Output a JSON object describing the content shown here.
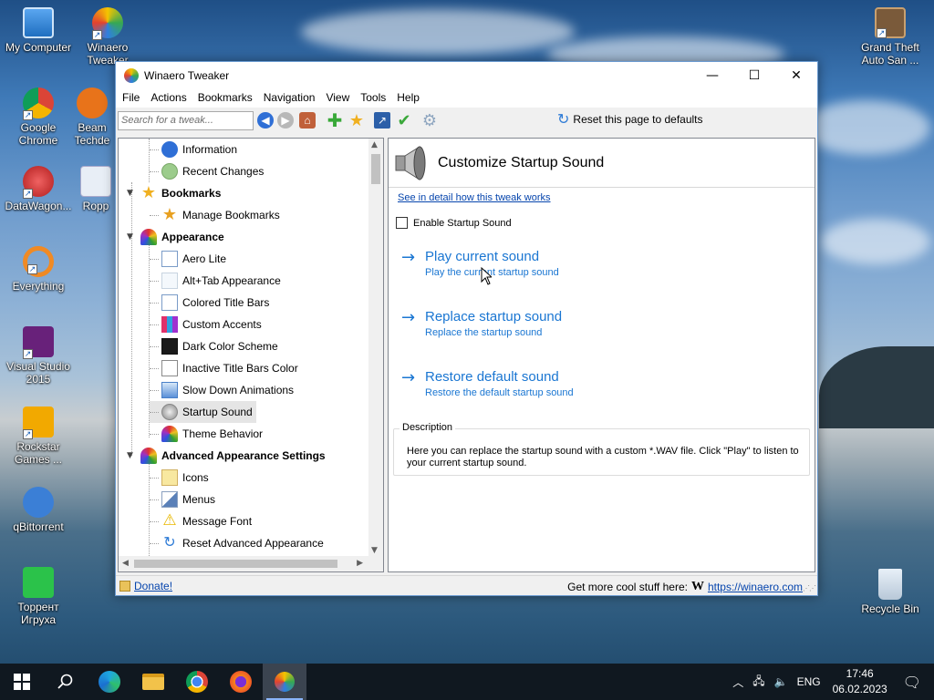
{
  "desktop": {
    "icons_left": [
      "My Computer",
      "Winaero Tweaker",
      "Google Chrome",
      "Beam Techde",
      "DataWagon...",
      "Ropp",
      "Everything",
      "Visual Studio 2015",
      "Rockstar Games ...",
      "qBittorrent",
      "Торрент Игруха"
    ],
    "icons_right": [
      "Grand Theft Auto San ...",
      "Recycle Bin"
    ]
  },
  "window": {
    "title": "Winaero Tweaker",
    "minimize": "—",
    "maximize": "☐",
    "close": "✕"
  },
  "menu": [
    "File",
    "Actions",
    "Bookmarks",
    "Navigation",
    "View",
    "Tools",
    "Help"
  ],
  "toolbar": {
    "search_placeholder": "Search for a tweak...",
    "reset_label": "Reset this page to defaults"
  },
  "tree": [
    {
      "label": "Information",
      "type": "item"
    },
    {
      "label": "Recent Changes",
      "type": "item"
    },
    {
      "label": "Bookmarks",
      "type": "cat"
    },
    {
      "label": "Manage Bookmarks",
      "type": "item"
    },
    {
      "label": "Appearance",
      "type": "cat"
    },
    {
      "label": "Aero Lite",
      "type": "item"
    },
    {
      "label": "Alt+Tab Appearance",
      "type": "item"
    },
    {
      "label": "Colored Title Bars",
      "type": "item"
    },
    {
      "label": "Custom Accents",
      "type": "item"
    },
    {
      "label": "Dark Color Scheme",
      "type": "item"
    },
    {
      "label": "Inactive Title Bars Color",
      "type": "item"
    },
    {
      "label": "Slow Down Animations",
      "type": "item"
    },
    {
      "label": "Startup Sound",
      "type": "item",
      "selected": true
    },
    {
      "label": "Theme Behavior",
      "type": "item"
    },
    {
      "label": "Advanced Appearance Settings",
      "type": "cat"
    },
    {
      "label": "Icons",
      "type": "item"
    },
    {
      "label": "Menus",
      "type": "item"
    },
    {
      "label": "Message Font",
      "type": "item"
    },
    {
      "label": "Reset Advanced Appearance",
      "type": "item"
    }
  ],
  "content": {
    "title": "Customize Startup Sound",
    "detail_link": "See in detail how this tweak works",
    "checkbox_label": "Enable Startup Sound",
    "actions": [
      {
        "title": "Play current sound",
        "subtitle": "Play the current startup sound"
      },
      {
        "title": "Replace startup sound",
        "subtitle": "Replace the startup sound"
      },
      {
        "title": "Restore default sound",
        "subtitle": "Restore the default startup sound"
      }
    ],
    "description_legend": "Description",
    "description_text": "Here you can replace the startup sound with a custom *.WAV file. Click \"Play\" to listen to your current startup sound."
  },
  "status": {
    "donate": "Donate!",
    "more_label": "Get more cool stuff here:",
    "url": "https://winaero.com"
  },
  "taskbar": {
    "language": "ENG",
    "time": "17:46",
    "date": "06.02.2023"
  }
}
